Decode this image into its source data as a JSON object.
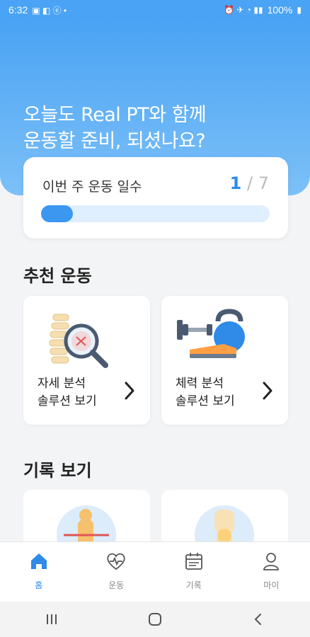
{
  "status_bar": {
    "time": "6:32",
    "battery": "100%"
  },
  "hero": {
    "title_line1": "오늘도 Real PT와 함께",
    "title_line2": "운동할 준비, 되셨나요?"
  },
  "week_card": {
    "label": "이번 주 운동 일수",
    "done": "1",
    "total": "/ 7",
    "progress": 0.14
  },
  "recommend": {
    "title": "추천 운동",
    "cards": [
      {
        "line1": "자세 분석",
        "line2": "솔루션 보기"
      },
      {
        "line1": "체력 분석",
        "line2": "솔루션 보기"
      }
    ]
  },
  "records": {
    "title": "기록 보기"
  },
  "bottom_nav": [
    {
      "label": "홈",
      "icon": "home-icon",
      "active": true
    },
    {
      "label": "운동",
      "icon": "heart-pulse-icon",
      "active": false
    },
    {
      "label": "기록",
      "icon": "calendar-icon",
      "active": false
    },
    {
      "label": "마이",
      "icon": "user-icon",
      "active": false
    }
  ],
  "colors": {
    "primary": "#2f8ae8",
    "hero_top": "#4aa3f4",
    "hero_bottom": "#7cc0f7",
    "track": "#e0efff"
  }
}
